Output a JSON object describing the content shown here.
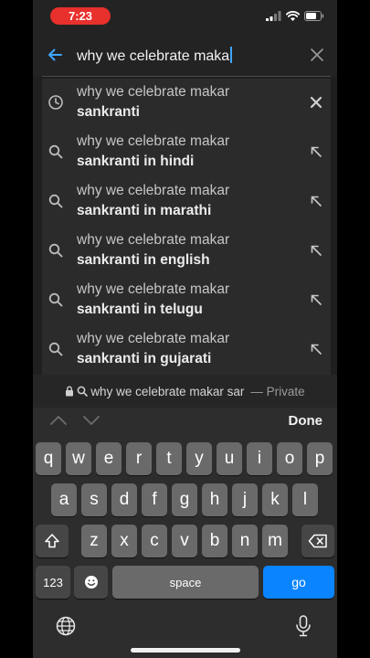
{
  "status_bar": {
    "time": "7:23"
  },
  "search": {
    "query": "why we celebrate maka"
  },
  "suggestions": [
    {
      "line1": "why we celebrate makar",
      "line2": "sankranti",
      "type": "history"
    },
    {
      "line1": "why we celebrate makar",
      "line2": "sankranti in hindi",
      "type": "search"
    },
    {
      "line1": "why we celebrate makar",
      "line2": "sankranti in marathi",
      "type": "search"
    },
    {
      "line1": "why we celebrate makar",
      "line2": "sankranti in english",
      "type": "search"
    },
    {
      "line1": "why we celebrate makar",
      "line2": "sankranti in telugu",
      "type": "search"
    },
    {
      "line1": "why we celebrate makar",
      "line2": "sankranti in gujarati",
      "type": "search"
    }
  ],
  "private_bar": {
    "text": "why we celebrate makar sar",
    "mode": "— Private"
  },
  "keyboard_toolbar": {
    "done_label": "Done"
  },
  "keyboard": {
    "row1": [
      "q",
      "w",
      "e",
      "r",
      "t",
      "y",
      "u",
      "i",
      "o",
      "p"
    ],
    "row2": [
      "a",
      "s",
      "d",
      "f",
      "g",
      "h",
      "j",
      "k",
      "l"
    ],
    "row3": [
      "z",
      "x",
      "c",
      "v",
      "b",
      "n",
      "m"
    ],
    "numbers_label": "123",
    "space_label": "space",
    "go_label": "go"
  },
  "colors": {
    "accent": "#0a84ff",
    "time_pill": "#e8302c",
    "caret": "#3ea6ff"
  }
}
